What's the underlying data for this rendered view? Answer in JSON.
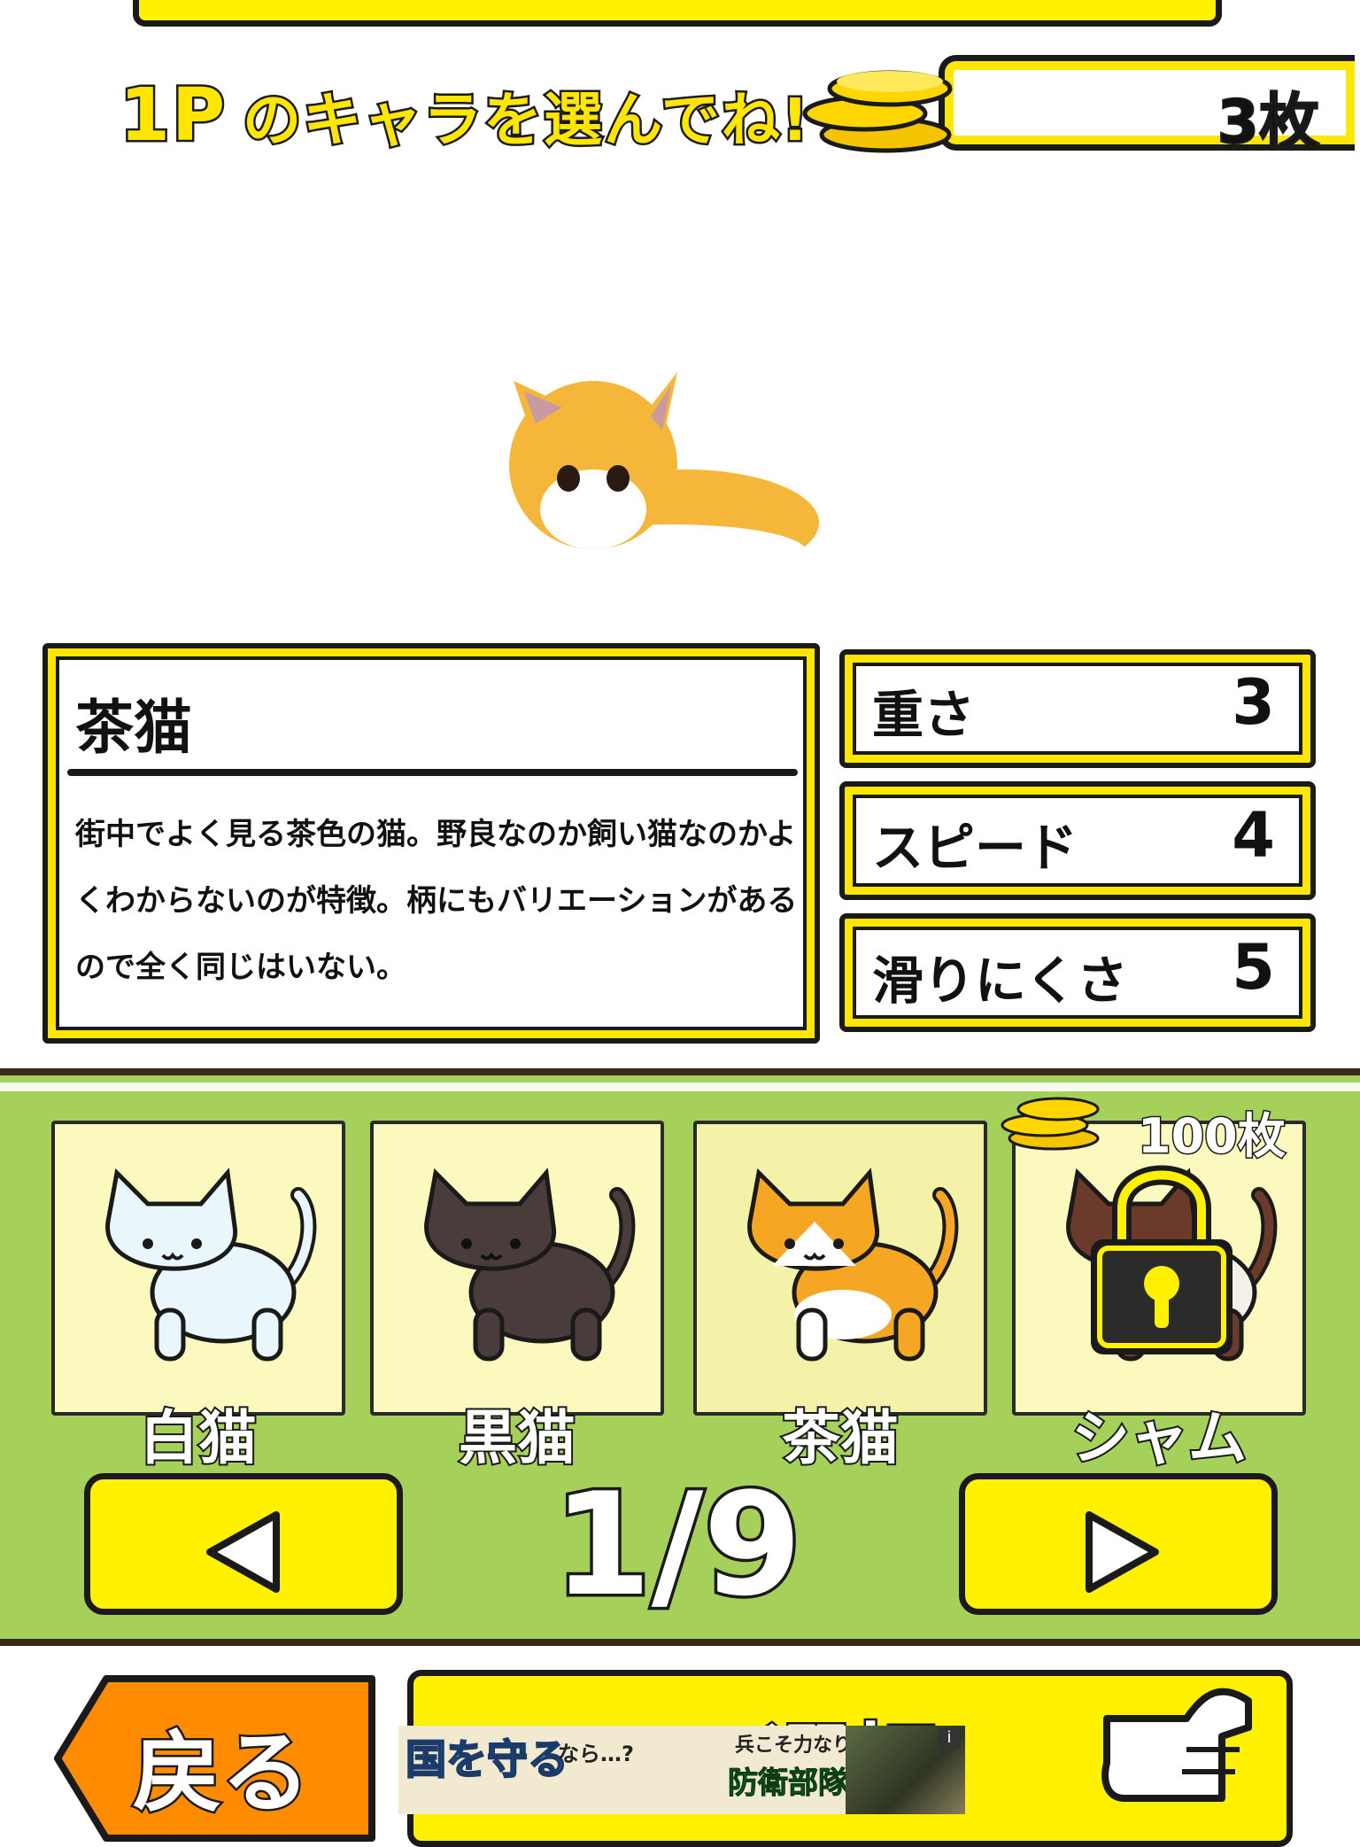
{
  "header": {
    "prompt_player": "1P",
    "prompt_text": "のキャラを選んでね!",
    "coin_count": "3枚"
  },
  "character": {
    "name": "茶猫",
    "description": "街中でよく見る茶色の猫。野良なのか飼い猫なのかよくわからないのが特徴。柄にもバリエーションがあるので全く同じはいない。",
    "stats": [
      {
        "label": "重さ",
        "value": "3"
      },
      {
        "label": "スピード",
        "value": "4"
      },
      {
        "label": "滑りにくさ",
        "value": "5"
      }
    ]
  },
  "roster": {
    "cards": [
      {
        "name": "白猫",
        "locked": false,
        "icon": "white-cat-icon"
      },
      {
        "name": "黒猫",
        "locked": false,
        "icon": "black-cat-icon"
      },
      {
        "name": "茶猫",
        "locked": false,
        "icon": "orange-cat-icon"
      },
      {
        "name": "シャム",
        "locked": true,
        "icon": "siamese-cat-icon",
        "price": "100枚"
      }
    ],
    "page": "1/9"
  },
  "footer": {
    "back_label": "戻る",
    "confirm_label": "選択"
  },
  "ad": {
    "headline": "国を守る",
    "suffix": "なら…?",
    "tagline": "兵こそ力なり",
    "title": "防衛部隊"
  },
  "colors": {
    "accent_yellow": "#fff100",
    "panel_green": "#a5d05a",
    "back_orange": "#ff8c00"
  }
}
